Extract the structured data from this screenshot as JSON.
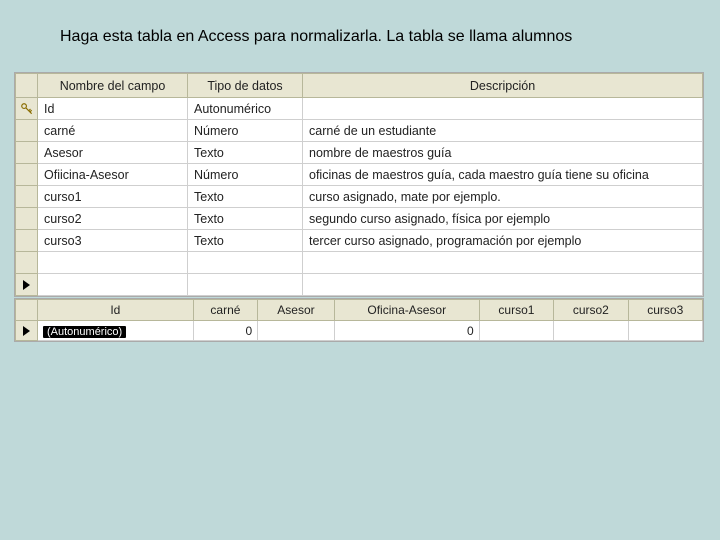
{
  "instruction": "Haga esta tabla en Access para normalizarla. La tabla se llama alumnos",
  "design": {
    "headers": {
      "name": "Nombre del campo",
      "type": "Tipo de datos",
      "desc": "Descripción"
    },
    "rows": [
      {
        "key": true,
        "name": "Id",
        "type": "Autonumérico",
        "desc": ""
      },
      {
        "key": false,
        "name": "carné",
        "type": "Número",
        "desc": "carné de un estudiante"
      },
      {
        "key": false,
        "name": "Asesor",
        "type": "Texto",
        "desc": "nombre de maestros guía"
      },
      {
        "key": false,
        "name": "Ofiicina-Asesor",
        "type": "Número",
        "desc": "oficinas de maestros guía, cada maestro guía tiene su oficina"
      },
      {
        "key": false,
        "name": "curso1",
        "type": "Texto",
        "desc": "curso asignado, mate por ejemplo."
      },
      {
        "key": false,
        "name": "curso2",
        "type": "Texto",
        "desc": "segundo curso asignado, física por ejemplo"
      },
      {
        "key": false,
        "name": "curso3",
        "type": "Texto",
        "desc": "tercer curso asignado, programación por ejemplo"
      }
    ]
  },
  "datasheet": {
    "columns": [
      "Id",
      "carné",
      "Asesor",
      "Oficina-Asesor",
      "curso1",
      "curso2",
      "curso3"
    ],
    "newrow": {
      "id_placeholder": "(Autonumérico)",
      "carne": "0",
      "asesor": "",
      "oficina": "0",
      "curso1": "",
      "curso2": "",
      "curso3": ""
    }
  }
}
